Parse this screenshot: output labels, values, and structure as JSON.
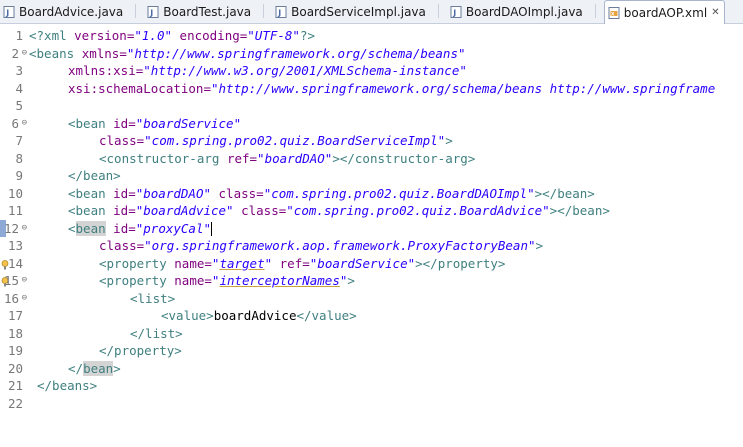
{
  "tabs": [
    {
      "label": "BoardAdvice.java",
      "icon": "java-file-icon",
      "active": false
    },
    {
      "label": "BoardTest.java",
      "icon": "java-file-icon",
      "active": false
    },
    {
      "label": "BoardServiceImpl.java",
      "icon": "java-file-icon",
      "active": false
    },
    {
      "label": "BoardDAOImpl.java",
      "icon": "java-file-icon",
      "active": false
    },
    {
      "label": "boardAOP.xml",
      "icon": "xml-file-icon",
      "active": true,
      "close": "✕"
    }
  ],
  "editor": {
    "line_numbers": [
      "1",
      "2",
      "3",
      "4",
      "5",
      "6",
      "7",
      "8",
      "9",
      "10",
      "11",
      "12",
      "13",
      "14",
      "15",
      "16",
      "17",
      "18",
      "19",
      "20",
      "21",
      "22"
    ],
    "current_line": 12,
    "text": {
      "l1_decl_open": "<?xml ",
      "l1_version_attr": "version=",
      "l1_version_val": "\"1.0\"",
      "l1_encoding_attr": " encoding=",
      "l1_encoding_val": "\"UTF-8\"",
      "l1_decl_close": "?>",
      "l2_open": "<beans ",
      "l2_attr": "xmlns=",
      "l2_val": "\"http://www.springframework.org/schema/beans\"",
      "l3_attr": "xmlns:xsi=",
      "l3_val": "\"http://www.w3.org/2001/XMLSchema-instance\"",
      "l4_attr": "xsi:schemaLocation=",
      "l4_val": "\"http://www.springframework.org/schema/beans http://www.springframe",
      "l6_open": "<bean ",
      "l6_attr": "id=",
      "l6_val": "\"boardService\"",
      "l7_attr": "class=",
      "l7_val": "\"com.spring.pro02.quiz.BoardServiceImpl\"",
      "l7_close": ">",
      "l8_open": "<constructor-arg ",
      "l8_attr": "ref=",
      "l8_val": "\"boardDAO\"",
      "l8_close": "></constructor-arg>",
      "l9_close": "</bean>",
      "l10_open": "<bean ",
      "l10_attr1": "id=",
      "l10_val1": "\"boardDAO\"",
      "l10_attr2": " class=",
      "l10_val2": "\"com.spring.pro02.quiz.BoardDAOImpl\"",
      "l10_close": "></bean>",
      "l11_open": "<bean ",
      "l11_attr1": "id=",
      "l11_val1": "\"boardAdvice\"",
      "l11_attr2": " class=",
      "l11_val2": "\"com.spring.pro02.quiz.BoardAdvice\"",
      "l11_close": "></bean>",
      "l12_lt": "<",
      "l12_tag": "bean",
      "l12_attr": " id=",
      "l12_val": "\"proxyCal\"",
      "l13_attr": "class=",
      "l13_val": "\"org.springframework.aop.framework.ProxyFactoryBean\"",
      "l13_close": ">",
      "l14_open": "<property ",
      "l14_attr1": "name=",
      "l14_val1_q1": "\"",
      "l14_val1_word": "target",
      "l14_val1_q2": "\"",
      "l14_attr2": " ref=",
      "l14_val2": "\"boardService\"",
      "l14_close": "></property>",
      "l15_open": "<property ",
      "l15_attr": "name=",
      "l15_val_q1": "\"",
      "l15_val_word": "interceptorNames",
      "l15_val_q2": "\"",
      "l15_close": ">",
      "l16_open": "<list>",
      "l17_open": "<value>",
      "l17_text": "boardAdvice",
      "l17_close": "</value>",
      "l18_close": "</list>",
      "l19_close": "</property>",
      "l20_lt": "</",
      "l20_tag": "bean",
      "l20_gt": ">",
      "l21_close": "</beans>"
    }
  },
  "colors": {
    "tag": "#3f7f7f",
    "attribute": "#7f007f",
    "value": "#2a00ff",
    "line_number": "#787878",
    "current_line_marker": "#8fa9d6",
    "occurrence_highlight": "#d4d4d4"
  }
}
